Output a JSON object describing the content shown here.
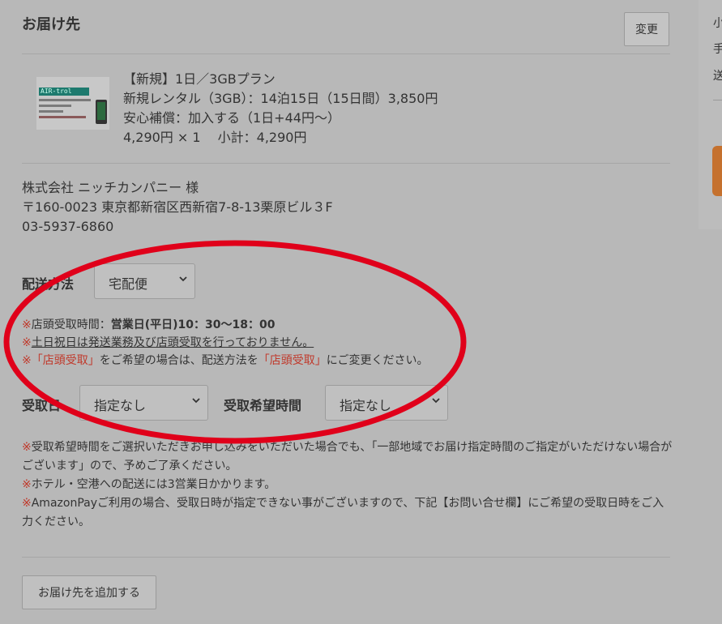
{
  "section": {
    "title": "お届け先",
    "change_label": "変更"
  },
  "product": {
    "image_text": "AIR-trol",
    "name": "【新規】1日／3GBプラン",
    "rental": "新規レンタル（3GB）：14泊15日（15日間）3,850円",
    "insurance": "安心補償：加入する（1日+44円〜）",
    "price_line": "4,290円 × 1　 小計：4,290円"
  },
  "address": {
    "company": "株式会社 ニッチカンパニー 様",
    "postal": "〒160-0023 東京都新宿区西新宿7-8-13栗原ビル３F",
    "phone": "03-5937-6860"
  },
  "shipping": {
    "label": "配送方法",
    "value": "宅配便"
  },
  "store_notes": {
    "n1_prefix": "※",
    "n1_label": "店頭受取時間：",
    "n1_hours": "営業日(平日)10：30〜18：00",
    "n2_prefix": "※",
    "n2_text": "土日祝日は発送業務及び店頭受取を行っておりません。",
    "n3_prefix": "※",
    "n3_q1": "「店頭受取」",
    "n3_mid": "をご希望の場合は、配送方法を",
    "n3_q2": "「店頭受取」",
    "n3_end": "にご変更ください。"
  },
  "receive": {
    "date_label": "受取日",
    "date_value": "指定なし",
    "time_label": "受取希望時間",
    "time_value": "指定なし"
  },
  "notes": {
    "a_mark": "※",
    "a_text": "受取希望時間をご選択いただきお申し込みをいただいた場合でも、「一部地域でお届け指定時間のご指定がいただけない場合がございます」ので、予めご了承ください。",
    "b_mark": "※",
    "b_text": "ホテル・空港への配送には3営業日かかります。",
    "c_mark": "※",
    "c_text": "AmazonPayご利用の場合、受取日時が指定できない事がございますので、下記【お問い合せ欄】にご希望の受取日時をご入力ください。"
  },
  "add_button": "お届け先を追加する",
  "side_panel": {
    "c1": "小",
    "c2": "手",
    "c3": "送"
  },
  "colors": {
    "highlight": "#e0001a",
    "note_red": "#c0392b",
    "accent": "#c5712e"
  }
}
